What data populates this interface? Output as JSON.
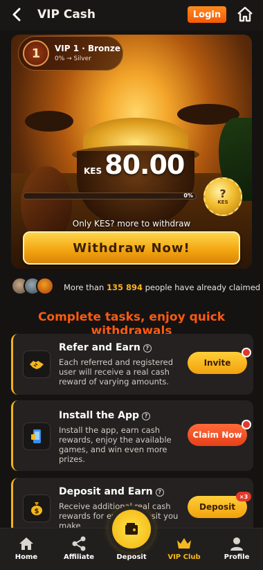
{
  "header": {
    "title": "VIP Cash",
    "login_label": "Login"
  },
  "vip": {
    "level_number": "1",
    "name": "VIP 1 · Bronze",
    "subtitle": "0% → Silver"
  },
  "balance": {
    "currency": "KES",
    "amount": "80.00",
    "progress_percent_label": "0%",
    "progress_fraction": 0.0,
    "coin_symbol": "?",
    "coin_label": "KES",
    "hint": "Only KES? more to withdraw",
    "withdraw_label": "Withdraw Now!"
  },
  "claimed": {
    "prefix": "More than ",
    "count": "135 894",
    "suffix": " people have already claimed"
  },
  "section_title": "Complete tasks, enjoy quick withdrawals",
  "tasks": [
    {
      "title": "Refer and Earn",
      "help": "?",
      "description": "Each referred and registered user will receive a real cash reward of varying amounts.",
      "button_label": "Invite",
      "icon": "handshake-icon"
    },
    {
      "title": "Install the App",
      "help": "?",
      "description": "Install the app, earn cash rewards, enjoy the available games, and win even more prizes.",
      "button_label": "Claim Now",
      "icon": "phone-icon"
    },
    {
      "title": "Deposit and Earn",
      "help": "?",
      "description": "Receive additional real cash rewards for every deposit you make",
      "button_label": "Deposit",
      "badge": "×3",
      "icon": "money-bag-icon"
    }
  ],
  "nav": {
    "items": [
      {
        "label": "Home",
        "icon": "home-icon"
      },
      {
        "label": "Affiliate",
        "icon": "share-icon"
      },
      {
        "label": "Deposit",
        "icon": "wallet-icon"
      },
      {
        "label": "VIP Club",
        "icon": "crown-icon"
      },
      {
        "label": "Profile",
        "icon": "user-icon"
      }
    ],
    "active": "VIP Club"
  },
  "colors": {
    "accent": "#f5b81e",
    "login": "#f25a06",
    "section_title": "#ff5a10",
    "claimed_count": "#ffb21a"
  }
}
